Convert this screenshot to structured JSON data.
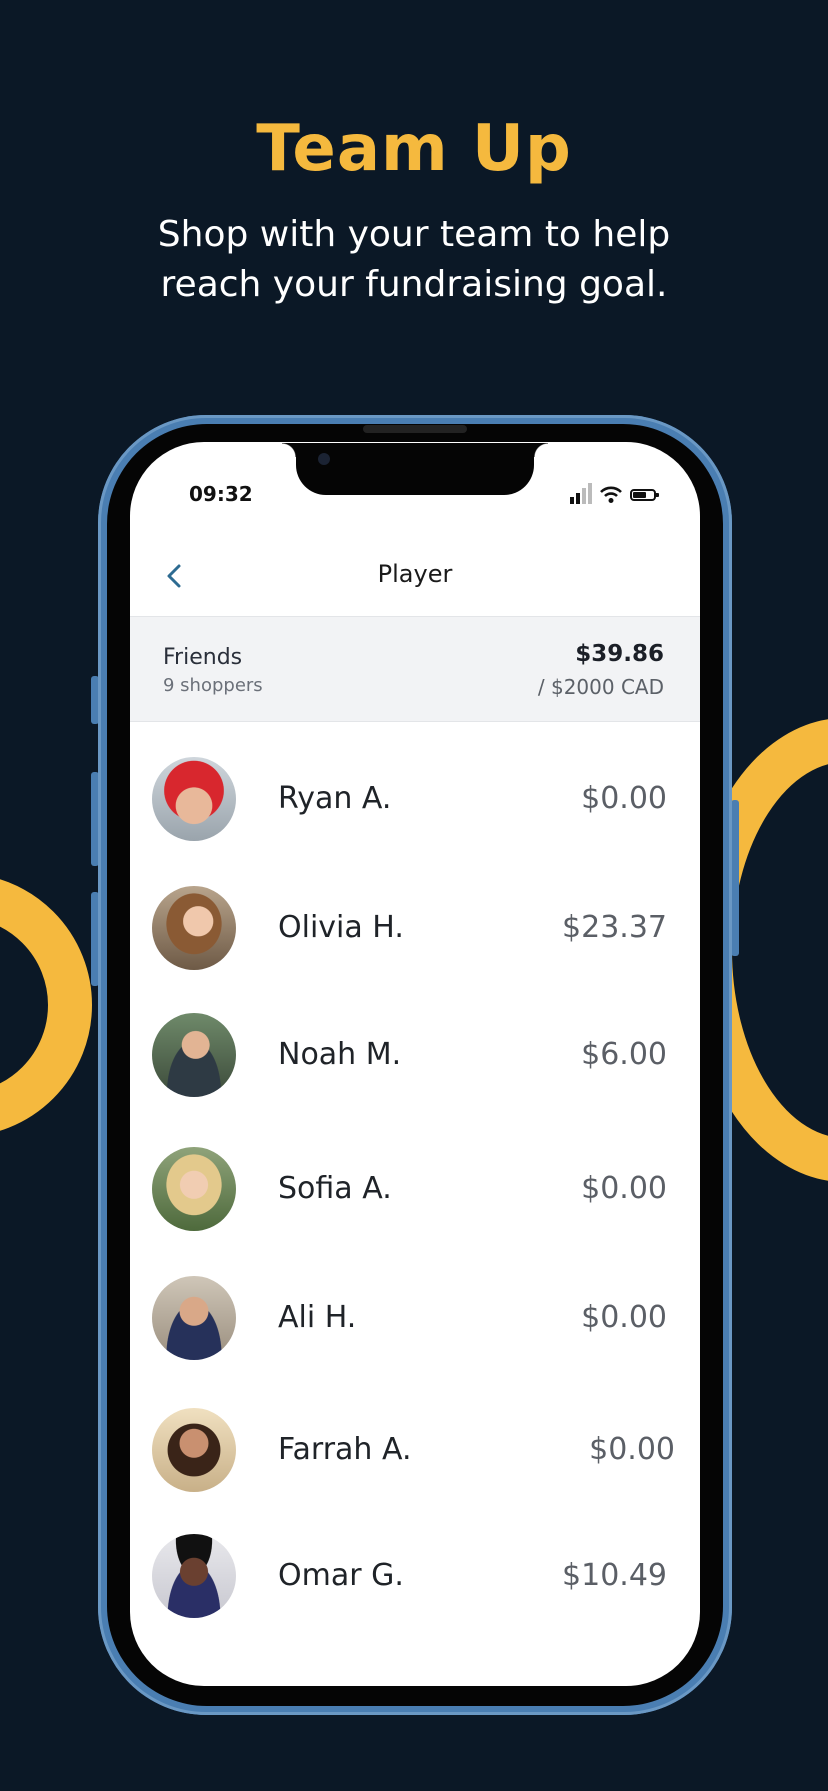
{
  "promo": {
    "headline": "Team Up",
    "subline_1": "Shop with your team  to help",
    "subline_2": "reach your fundraising goal."
  },
  "colors": {
    "background": "#0b1826",
    "accent": "#f5b93e",
    "phone_frame": "#4a7eb2"
  },
  "status_bar": {
    "time": "09:32",
    "icons": [
      "cellular-signal-icon",
      "wifi-icon",
      "battery-icon"
    ]
  },
  "nav": {
    "back_icon": "chevron-left-icon",
    "title": "Player"
  },
  "team": {
    "name": "Friends",
    "shoppers": "9 shoppers",
    "raised": "$39.86",
    "goal": "/ $2000 CAD"
  },
  "players": [
    {
      "name": "Ryan A.",
      "amount": "$0.00"
    },
    {
      "name": "Olivia H.",
      "amount": "$23.37"
    },
    {
      "name": "Noah M.",
      "amount": "$6.00"
    },
    {
      "name": "Sofia A.",
      "amount": "$0.00"
    },
    {
      "name": "Ali H.",
      "amount": "$0.00"
    },
    {
      "name": "Farrah A.",
      "amount": "$0.00"
    },
    {
      "name": "Omar G.",
      "amount": "$10.49"
    }
  ]
}
